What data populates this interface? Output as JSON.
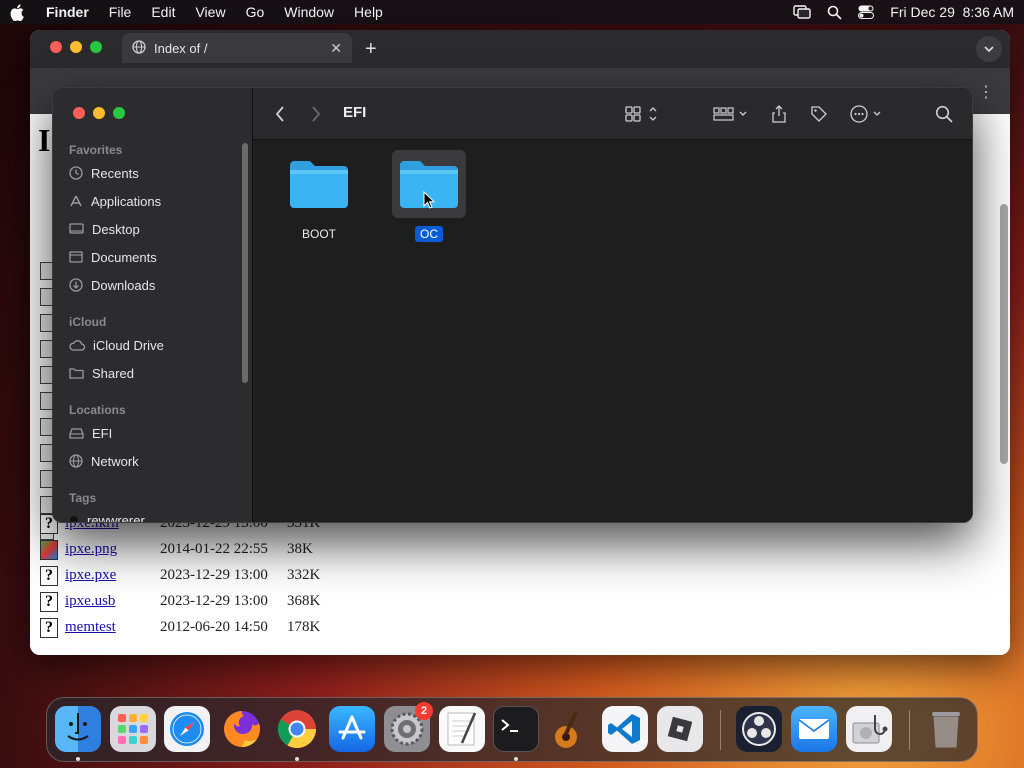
{
  "menubar": {
    "app": "Finder",
    "items": [
      "File",
      "Edit",
      "View",
      "Go",
      "Window",
      "Help"
    ],
    "datetime": "Fri Dec 29  8:36 AM"
  },
  "browser": {
    "tab_title": "Index of /",
    "heading": "I",
    "rows": [
      {
        "name": "ipxe.lkrn",
        "date": "2023-12-29 13:00",
        "size": "331K",
        "icon": "unknown-file-icon"
      },
      {
        "name": "ipxe.png",
        "date": "2014-01-22 22:55",
        "size": "38K",
        "icon": "image-file-icon"
      },
      {
        "name": "ipxe.pxe",
        "date": "2023-12-29 13:00",
        "size": "332K",
        "icon": "unknown-file-icon"
      },
      {
        "name": "ipxe.usb",
        "date": "2023-12-29 13:00",
        "size": "368K",
        "icon": "unknown-file-icon"
      },
      {
        "name": "memtest",
        "date": "2012-06-20 14:50",
        "size": "178K",
        "icon": "unknown-file-icon"
      }
    ]
  },
  "finder": {
    "title": "EFI",
    "sidebar": {
      "favorites_label": "Favorites",
      "favorites": [
        {
          "label": "Recents",
          "icon": "clock-icon"
        },
        {
          "label": "Applications",
          "icon": "applications-icon"
        },
        {
          "label": "Desktop",
          "icon": "desktop-icon"
        },
        {
          "label": "Documents",
          "icon": "document-icon"
        },
        {
          "label": "Downloads",
          "icon": "download-icon"
        }
      ],
      "icloud_label": "iCloud",
      "icloud": [
        {
          "label": "iCloud Drive",
          "icon": "cloud-icon"
        },
        {
          "label": "Shared",
          "icon": "shared-folder-icon"
        }
      ],
      "locations_label": "Locations",
      "locations": [
        {
          "label": "EFI",
          "icon": "drive-icon"
        },
        {
          "label": "Network",
          "icon": "globe-icon"
        }
      ],
      "tags_label": "Tags",
      "tags": [
        {
          "label": "rewwrerer"
        }
      ]
    },
    "folders": [
      {
        "label": "BOOT",
        "selected": false
      },
      {
        "label": "OC",
        "selected": true
      }
    ]
  },
  "dock": {
    "apps": [
      {
        "name": "finder",
        "running": true
      },
      {
        "name": "launchpad",
        "running": false
      },
      {
        "name": "safari",
        "running": false
      },
      {
        "name": "firefox",
        "running": false
      },
      {
        "name": "chrome",
        "running": true
      },
      {
        "name": "app-store",
        "running": false
      },
      {
        "name": "system-settings",
        "running": false,
        "badge": "2"
      },
      {
        "name": "textedit",
        "running": false
      },
      {
        "name": "terminal",
        "running": true
      },
      {
        "name": "garageband",
        "running": false
      },
      {
        "name": "vscode",
        "running": false
      },
      {
        "name": "roblox",
        "running": false
      },
      {
        "name": "obs",
        "running": false
      },
      {
        "name": "mail",
        "running": false
      },
      {
        "name": "disk-utility",
        "running": false
      },
      {
        "name": "trash",
        "running": false
      }
    ]
  },
  "colors": {
    "selection": "#0a5cd5",
    "folder": "#3ab4f2",
    "link": "#1a0dab"
  }
}
